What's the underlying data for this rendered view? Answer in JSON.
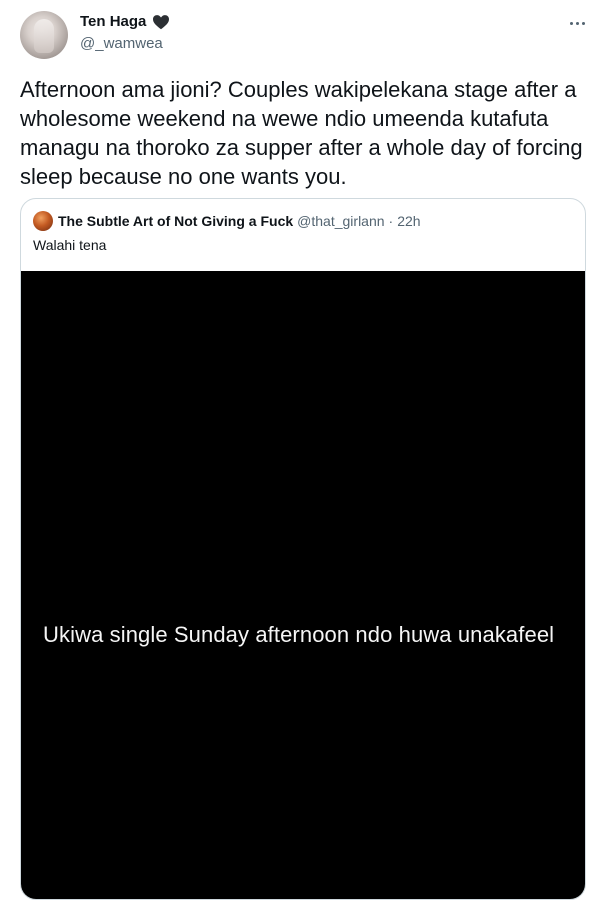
{
  "tweet": {
    "author": {
      "display_name": "Ten Haga",
      "handle": "@_wamwea",
      "avatar_icon": "profile-photo"
    },
    "menu_icon": "more-options-icon",
    "text": "Afternoon ama jioni? Couples wakipelekana stage after a wholesome weekend na wewe ndio umeenda kutafuta managu na thoroko za supper after a whole day of forcing sleep because no one wants you."
  },
  "quoted_tweet": {
    "author_name": "The Subtle Art of Not Giving a Fuck",
    "handle": "@that_girlann",
    "separator": "·",
    "time": "22h",
    "text": "Walahi tena",
    "media": {
      "caption": "Ukiwa single Sunday afternoon ndo huwa unakafeel",
      "background": "#000000"
    }
  },
  "colors": {
    "text_primary": "#0f1419",
    "text_secondary": "#536471",
    "border": "#cfd9de"
  }
}
